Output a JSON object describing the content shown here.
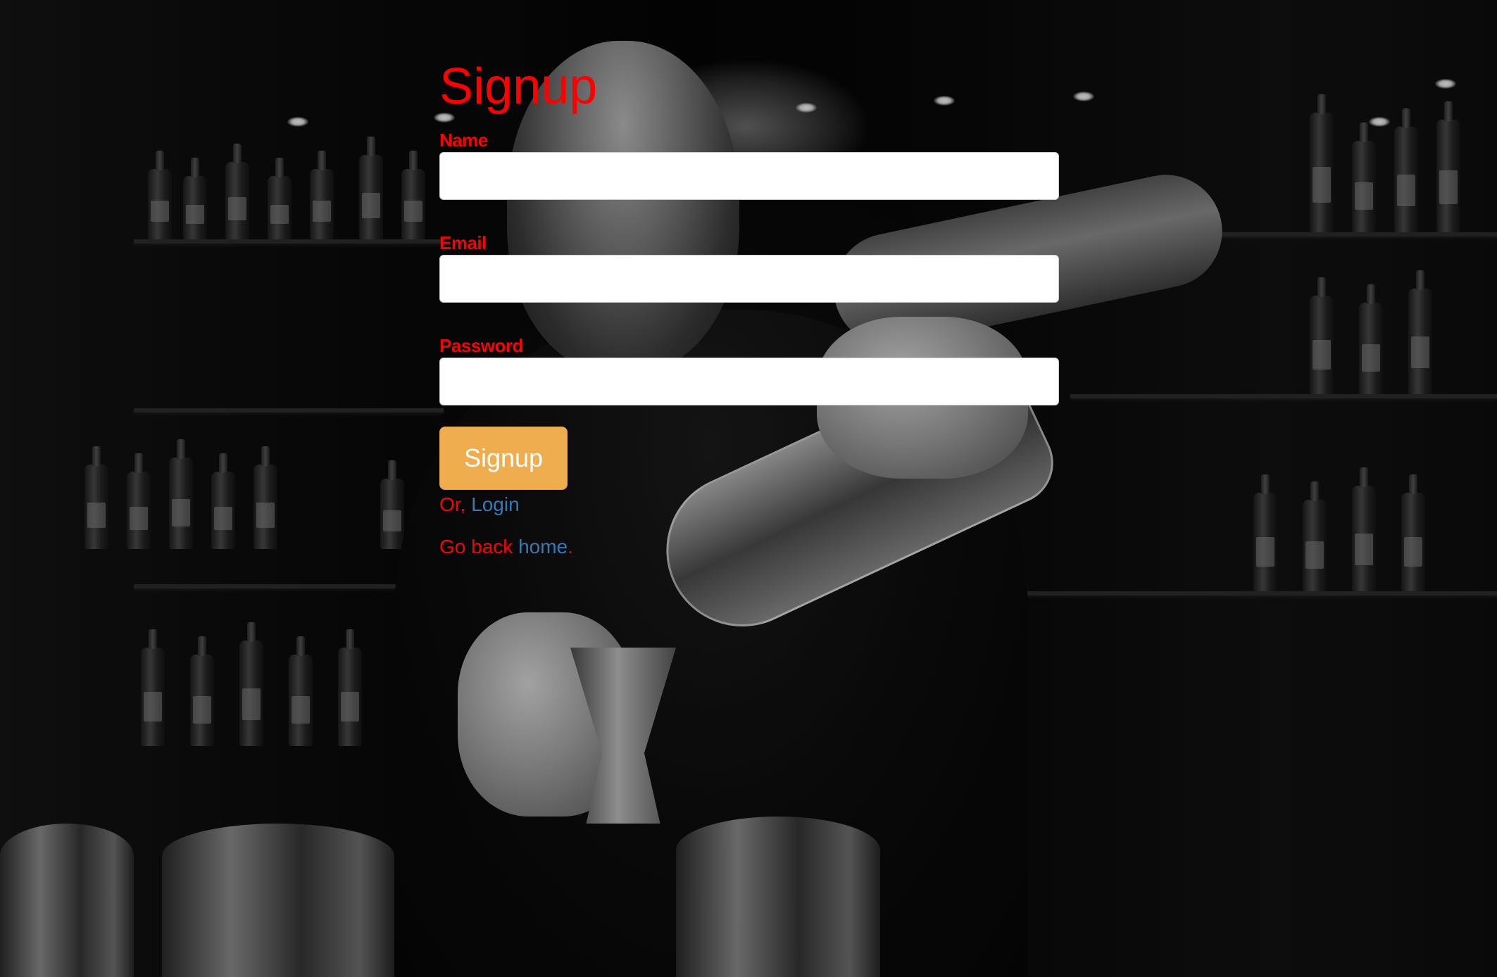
{
  "form": {
    "title": "Signup",
    "fields": [
      {
        "label": "Name",
        "value": "",
        "type": "text"
      },
      {
        "label": "Email",
        "value": "",
        "type": "email"
      },
      {
        "label": "Password",
        "value": "",
        "type": "password"
      }
    ],
    "submit_label": "Signup",
    "login_prefix": "Or, ",
    "login_link": "Login",
    "home_prefix": "Go back ",
    "home_link": "home",
    "home_suffix": "."
  },
  "colors": {
    "text_accent": "#ff0000",
    "link": "#337ab7",
    "button": "#f0ad4e"
  }
}
